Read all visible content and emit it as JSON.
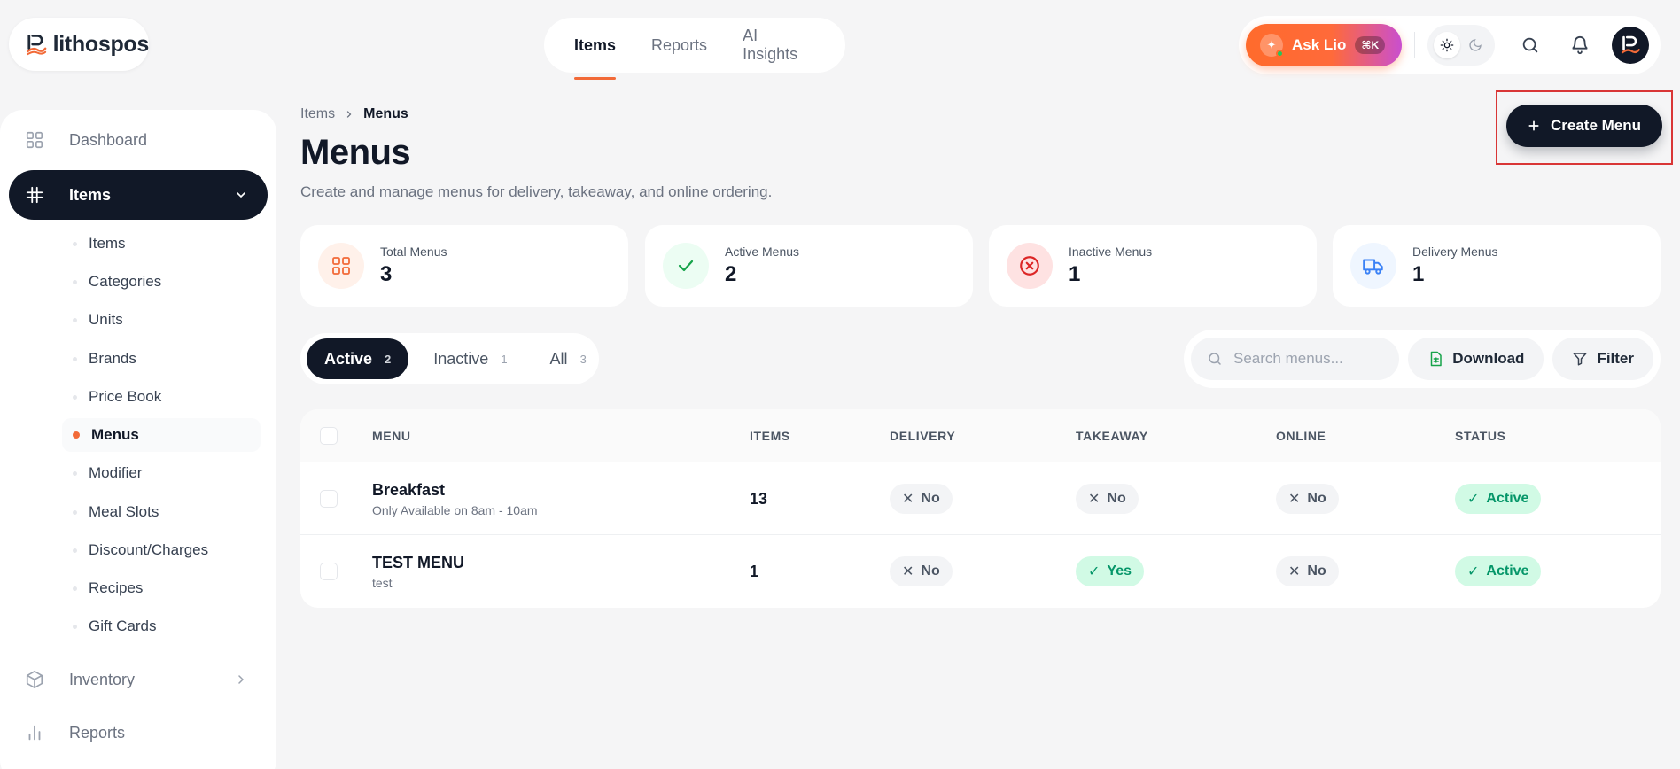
{
  "brand": {
    "name": "lithospos",
    "accent": "#f26a38"
  },
  "topnav": {
    "tabs": [
      {
        "label": "Items",
        "active": true
      },
      {
        "label": "Reports"
      },
      {
        "label": "AI Insights"
      }
    ]
  },
  "header": {
    "ask_label": "Ask Lio",
    "ask_shortcut": "⌘K"
  },
  "sidebar": {
    "items": [
      {
        "label": "Dashboard",
        "icon": "grid-icon"
      },
      {
        "label": "Items",
        "icon": "items-icon",
        "active": true
      },
      {
        "label": "Inventory",
        "icon": "box-icon"
      },
      {
        "label": "Reports",
        "icon": "bar-chart-icon"
      }
    ],
    "subitems": [
      {
        "label": "Items"
      },
      {
        "label": "Categories"
      },
      {
        "label": "Units"
      },
      {
        "label": "Brands"
      },
      {
        "label": "Price Book"
      },
      {
        "label": "Menus",
        "active": true
      },
      {
        "label": "Modifier"
      },
      {
        "label": "Meal Slots"
      },
      {
        "label": "Discount/Charges"
      },
      {
        "label": "Recipes"
      },
      {
        "label": "Gift Cards"
      }
    ]
  },
  "breadcrumb": {
    "parent": "Items",
    "current": "Menus"
  },
  "page": {
    "title": "Menus",
    "subtitle": "Create and manage menus for delivery, takeaway, and online ordering.",
    "create_label": "Create Menu"
  },
  "stats": [
    {
      "label": "Total Menus",
      "value": "3",
      "icon": "grid-icon",
      "color": "#f26a38"
    },
    {
      "label": "Active Menus",
      "value": "2",
      "icon": "check-icon",
      "color": "#16a34a"
    },
    {
      "label": "Inactive Menus",
      "value": "1",
      "icon": "x-circle-icon",
      "color": "#dc2626"
    },
    {
      "label": "Delivery Menus",
      "value": "1",
      "icon": "truck-icon",
      "color": "#3b82f6"
    }
  ],
  "filters": {
    "tabs": [
      {
        "label": "Active",
        "count": "2",
        "active": true
      },
      {
        "label": "Inactive",
        "count": "1"
      },
      {
        "label": "All",
        "count": "3"
      }
    ],
    "search_placeholder": "Search menus...",
    "download_label": "Download",
    "filter_label": "Filter"
  },
  "table": {
    "columns": [
      "MENU",
      "ITEMS",
      "DELIVERY",
      "TAKEAWAY",
      "ONLINE",
      "STATUS"
    ],
    "rows": [
      {
        "name": "Breakfast",
        "desc": "Only Available on 8am - 10am",
        "items": "13",
        "delivery": "No",
        "takeaway": "No",
        "online": "No",
        "status": "Active"
      },
      {
        "name": "TEST MENU",
        "desc": "test",
        "items": "1",
        "delivery": "No",
        "takeaway": "Yes",
        "online": "No",
        "status": "Active"
      }
    ]
  }
}
